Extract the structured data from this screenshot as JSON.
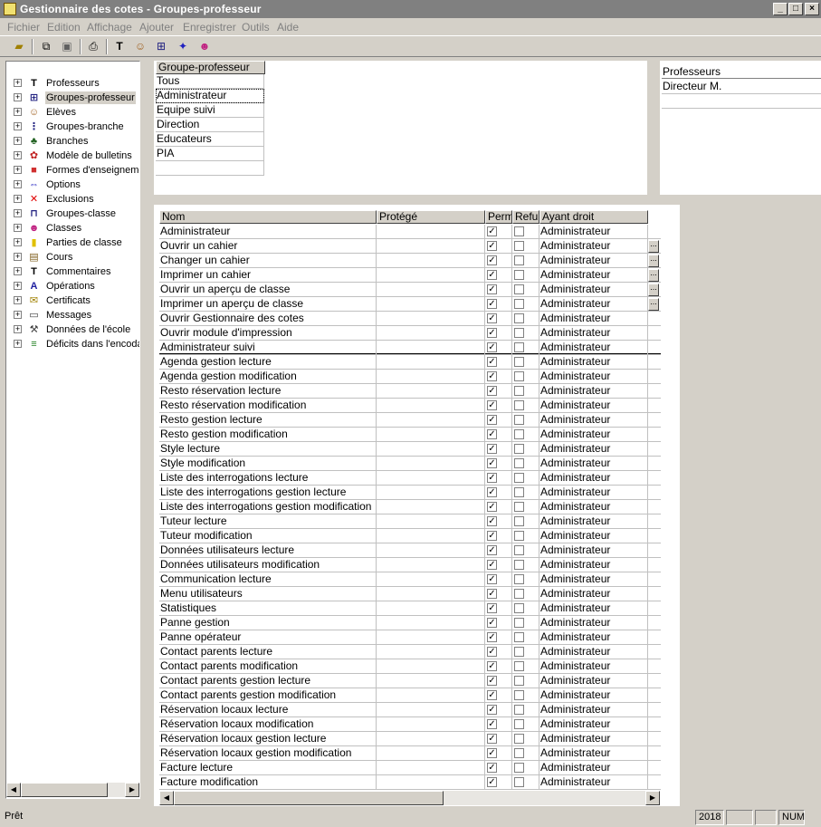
{
  "window": {
    "title": "Gestionnaire des cotes - Groupes-professeur",
    "minimize_label": "_",
    "maximize_label": "□",
    "close_label": "×"
  },
  "menu": {
    "items": [
      "Fichier",
      "Edition",
      "Affichage",
      "Ajouter",
      "Enregistrer",
      "Outils",
      "Aide"
    ]
  },
  "toolbar": {
    "icons": [
      "open-folder-icon",
      "copy-icon",
      "paste-icon",
      "print-icon",
      "professeurs-icon",
      "eleves-icon",
      "groupes-icon",
      "options-icon",
      "messages-icon"
    ]
  },
  "tree": {
    "items": [
      {
        "label": "Professeurs",
        "icon": "teacher-icon",
        "glyph": "T",
        "color": "#000000"
      },
      {
        "label": "Groupes-professeur",
        "icon": "teacher-group-icon",
        "glyph": "⊞",
        "color": "#202080",
        "selected": true
      },
      {
        "label": "Elèves",
        "icon": "students-icon",
        "glyph": "☺",
        "color": "#a06020"
      },
      {
        "label": "Groupes-branche",
        "icon": "branch-group-icon",
        "glyph": "⋮",
        "color": "#202080"
      },
      {
        "label": "Branches",
        "icon": "branches-icon",
        "glyph": "♣",
        "color": "#206020"
      },
      {
        "label": "Modèle de bulletins",
        "icon": "report-model-icon",
        "glyph": "✿",
        "color": "#c02020"
      },
      {
        "label": "Formes d'enseignement",
        "icon": "teaching-forms-icon",
        "glyph": "■",
        "color": "#d03030"
      },
      {
        "label": "Options",
        "icon": "options-icon",
        "glyph": "⇔",
        "color": "#2020c0"
      },
      {
        "label": "Exclusions",
        "icon": "exclusions-icon",
        "glyph": "✕",
        "color": "#e00000"
      },
      {
        "label": "Groupes-classe",
        "icon": "class-group-icon",
        "glyph": "⊓",
        "color": "#202080"
      },
      {
        "label": "Classes",
        "icon": "classes-icon",
        "glyph": "☻",
        "color": "#c02080"
      },
      {
        "label": "Parties de classe",
        "icon": "class-parts-icon",
        "glyph": "▮",
        "color": "#e0c000"
      },
      {
        "label": "Cours",
        "icon": "courses-icon",
        "glyph": "▤",
        "color": "#806020"
      },
      {
        "label": "Commentaires",
        "icon": "comments-icon",
        "glyph": "T",
        "color": "#000000"
      },
      {
        "label": "Opérations",
        "icon": "operations-icon",
        "glyph": "A",
        "color": "#2020a0"
      },
      {
        "label": "Certificats",
        "icon": "certificates-icon",
        "glyph": "✉",
        "color": "#a08000"
      },
      {
        "label": "Messages",
        "icon": "messages-icon",
        "glyph": "▭",
        "color": "#404040"
      },
      {
        "label": "Données de l'école",
        "icon": "school-data-icon",
        "glyph": "⚒",
        "color": "#404040"
      },
      {
        "label": "Déficits dans l'encodage",
        "icon": "deficits-icon",
        "glyph": "≡",
        "color": "#208020"
      }
    ]
  },
  "groups": {
    "header": "Groupe-professeur",
    "items": [
      "Tous",
      "Administrateur",
      "Equipe suivi",
      "Direction",
      "Educateurs",
      "PIA"
    ],
    "selected_index": 1
  },
  "professeurs": {
    "header": "Professeurs",
    "items": [
      "Directeur M."
    ]
  },
  "rights": {
    "columns": [
      "Nom",
      "Protégé",
      "Perm",
      "Refu",
      "Ayant droit"
    ],
    "rows": [
      {
        "name": "Administrateur",
        "perm": true,
        "refus": false,
        "ayant": "Administrateur"
      },
      {
        "name": "Ouvrir un cahier",
        "perm": true,
        "refus": false,
        "ayant": "Administrateur",
        "btn": true
      },
      {
        "name": "Changer un cahier",
        "perm": true,
        "refus": false,
        "ayant": "Administrateur",
        "btn": true
      },
      {
        "name": "Imprimer un cahier",
        "perm": true,
        "refus": false,
        "ayant": "Administrateur",
        "btn": true
      },
      {
        "name": "Ouvrir un aperçu de classe",
        "perm": true,
        "refus": false,
        "ayant": "Administrateur",
        "btn": true
      },
      {
        "name": "Imprimer un aperçu de classe",
        "perm": true,
        "refus": false,
        "ayant": "Administrateur",
        "btn": true
      },
      {
        "name": "Ouvrir Gestionnaire des cotes",
        "perm": true,
        "refus": false,
        "ayant": "Administrateur"
      },
      {
        "name": "Ouvrir module d'impression",
        "perm": true,
        "refus": false,
        "ayant": "Administrateur"
      },
      {
        "name": "Administrateur suivi",
        "perm": true,
        "refus": false,
        "ayant": "Administrateur"
      },
      {
        "name": "Agenda gestion lecture",
        "perm": true,
        "refus": false,
        "ayant": "Administrateur"
      },
      {
        "name": "Agenda gestion modification",
        "perm": true,
        "refus": false,
        "ayant": "Administrateur"
      },
      {
        "name": "Resto réservation lecture",
        "perm": true,
        "refus": false,
        "ayant": "Administrateur"
      },
      {
        "name": "Resto réservation modification",
        "perm": true,
        "refus": false,
        "ayant": "Administrateur"
      },
      {
        "name": "Resto gestion lecture",
        "perm": true,
        "refus": false,
        "ayant": "Administrateur"
      },
      {
        "name": "Resto gestion modification",
        "perm": true,
        "refus": false,
        "ayant": "Administrateur"
      },
      {
        "name": "Style lecture",
        "perm": true,
        "refus": false,
        "ayant": "Administrateur"
      },
      {
        "name": "Style modification",
        "perm": true,
        "refus": false,
        "ayant": "Administrateur"
      },
      {
        "name": "Liste des interrogations lecture",
        "perm": true,
        "refus": false,
        "ayant": "Administrateur"
      },
      {
        "name": "Liste des interrogations gestion lecture",
        "perm": true,
        "refus": false,
        "ayant": "Administrateur"
      },
      {
        "name": "Liste des interrogations gestion modification",
        "perm": true,
        "refus": false,
        "ayant": "Administrateur"
      },
      {
        "name": "Tuteur lecture",
        "perm": true,
        "refus": false,
        "ayant": "Administrateur"
      },
      {
        "name": "Tuteur modification",
        "perm": true,
        "refus": false,
        "ayant": "Administrateur"
      },
      {
        "name": "Données utilisateurs lecture",
        "perm": true,
        "refus": false,
        "ayant": "Administrateur"
      },
      {
        "name": "Données utilisateurs modification",
        "perm": true,
        "refus": false,
        "ayant": "Administrateur"
      },
      {
        "name": "Communication lecture",
        "perm": true,
        "refus": false,
        "ayant": "Administrateur"
      },
      {
        "name": "Menu utilisateurs",
        "perm": true,
        "refus": false,
        "ayant": "Administrateur"
      },
      {
        "name": "Statistiques",
        "perm": true,
        "refus": false,
        "ayant": "Administrateur"
      },
      {
        "name": "Panne gestion",
        "perm": true,
        "refus": false,
        "ayant": "Administrateur"
      },
      {
        "name": "Panne opérateur",
        "perm": true,
        "refus": false,
        "ayant": "Administrateur"
      },
      {
        "name": "Contact parents lecture",
        "perm": true,
        "refus": false,
        "ayant": "Administrateur"
      },
      {
        "name": "Contact parents modification",
        "perm": true,
        "refus": false,
        "ayant": "Administrateur"
      },
      {
        "name": "Contact parents gestion lecture",
        "perm": true,
        "refus": false,
        "ayant": "Administrateur"
      },
      {
        "name": "Contact parents gestion modification",
        "perm": true,
        "refus": false,
        "ayant": "Administrateur"
      },
      {
        "name": "Réservation locaux lecture",
        "perm": true,
        "refus": false,
        "ayant": "Administrateur"
      },
      {
        "name": "Réservation locaux modification",
        "perm": true,
        "refus": false,
        "ayant": "Administrateur"
      },
      {
        "name": "Réservation locaux gestion lecture",
        "perm": true,
        "refus": false,
        "ayant": "Administrateur"
      },
      {
        "name": "Réservation locaux gestion modification",
        "perm": true,
        "refus": false,
        "ayant": "Administrateur"
      },
      {
        "name": "Facture lecture",
        "perm": true,
        "refus": false,
        "ayant": "Administrateur"
      },
      {
        "name": "Facture modification",
        "perm": true,
        "refus": false,
        "ayant": "Administrateur"
      }
    ],
    "separator_after": 8,
    "dots_label": "..."
  },
  "status": {
    "text": "Prêt",
    "year": "2018",
    "num": "NUM"
  }
}
